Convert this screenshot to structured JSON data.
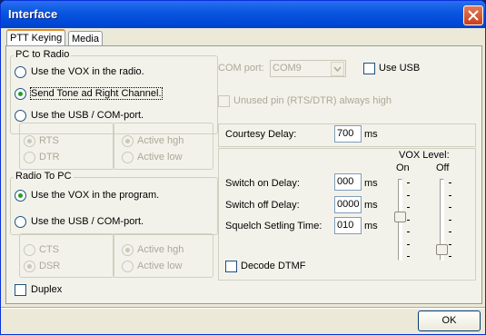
{
  "window": {
    "title": "Interface"
  },
  "tabs": [
    {
      "label": "PTT Keying",
      "active": true
    },
    {
      "label": "Media",
      "active": false
    }
  ],
  "pc_to_radio": {
    "label": "PC to Radio",
    "options": [
      {
        "label": "Use the VOX in the radio.",
        "checked": false
      },
      {
        "label": "Send Tone ad Right Channel.",
        "checked": true
      },
      {
        "label": "Use the USB / COM-port.",
        "checked": false
      }
    ],
    "pins": [
      {
        "label": "RTS",
        "checked": true
      },
      {
        "label": "DTR",
        "checked": false
      }
    ],
    "levels": [
      {
        "label": "Active hgh",
        "checked": true
      },
      {
        "label": "Active low",
        "checked": false
      }
    ]
  },
  "radio_to_pc": {
    "label": "Radio To PC",
    "options": [
      {
        "label": "Use the VOX in the program.",
        "checked": true
      },
      {
        "label": "Use the USB / COM-port.",
        "checked": false
      }
    ],
    "pins": [
      {
        "label": "CTS",
        "checked": false
      },
      {
        "label": "DSR",
        "checked": true
      }
    ],
    "levels": [
      {
        "label": "Active hgh",
        "checked": true
      },
      {
        "label": "Active low",
        "checked": false
      }
    ]
  },
  "duplex": {
    "label": "Duplex",
    "checked": false
  },
  "com_port": {
    "label": "COM port:",
    "value": "COM9"
  },
  "use_usb": {
    "label": "Use USB",
    "checked": false
  },
  "unused_pin": {
    "label": "Unused pin (RTS/DTR) always high",
    "checked": false
  },
  "courtesy": {
    "label": "Courtesy Delay:",
    "value": "700",
    "unit": "ms"
  },
  "delays": [
    {
      "label": "Switch on Delay:",
      "value": "000",
      "unit": "ms"
    },
    {
      "label": "Switch off Delay:",
      "value": "0000",
      "unit": "ms"
    },
    {
      "label": "Squelch Setling Time:",
      "value": "010",
      "unit": "ms"
    }
  ],
  "decode_dtmf": {
    "label": "Decode DTMF",
    "checked": false
  },
  "vox": {
    "title": "VOX Level:",
    "on_label": "On",
    "off_label": "Off",
    "on_level": 0.45,
    "off_level": 0.9
  },
  "ok_label": "OK"
}
